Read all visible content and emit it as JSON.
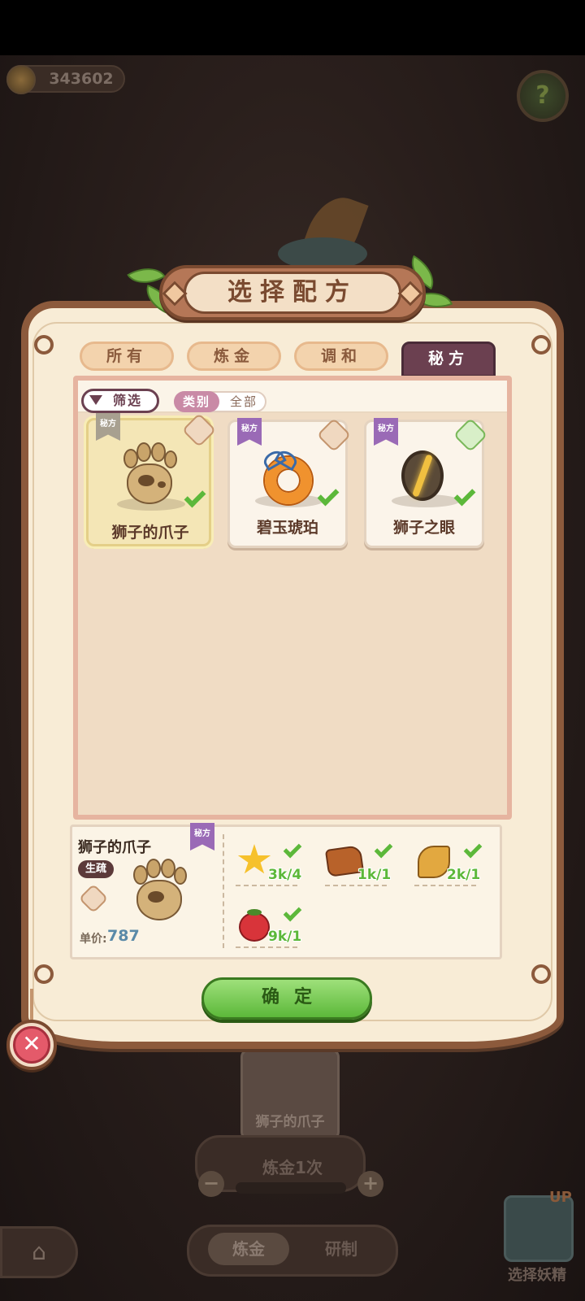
{
  "hud": {
    "coins": "343602"
  },
  "dialog": {
    "title": "选择配方",
    "tabs": [
      {
        "label": "所有",
        "active": false
      },
      {
        "label": "炼金",
        "active": false
      },
      {
        "label": "调和",
        "active": false
      },
      {
        "label": "秘方",
        "active": true
      }
    ],
    "filter": {
      "button_label": "筛选",
      "category_label": "类别",
      "category_value": "全部"
    },
    "recipes": [
      {
        "name": "狮子的爪子",
        "tag": "秘方",
        "icon": "paw-icon",
        "selected": true,
        "owned": true
      },
      {
        "name": "碧玉琥珀",
        "tag": "秘方",
        "icon": "amber-ring-icon",
        "selected": false,
        "owned": true
      },
      {
        "name": "狮子之眼",
        "tag": "秘方",
        "icon": "lion-eye-icon",
        "selected": false,
        "owned": true
      }
    ],
    "detail": {
      "name": "狮子的爪子",
      "tag": "秘方",
      "type_badge": "生疏",
      "price_label": "单价:",
      "price_value": "787",
      "ingredients": [
        {
          "icon": "star-icon",
          "count": "3k/4"
        },
        {
          "icon": "ore-icon",
          "count": "1k/1"
        },
        {
          "icon": "wheat-icon",
          "count": "2k/1"
        },
        {
          "icon": "tomato-icon",
          "count": "9k/1"
        }
      ]
    },
    "confirm_label": "确定"
  },
  "background": {
    "card_name": "狮子的爪子",
    "alchemy_count": "炼金1次",
    "nav": {
      "alchemy": "炼金",
      "research": "研制"
    },
    "fairy_label": "选择妖精",
    "fairy_up": "UP"
  },
  "colors": {
    "panel": "#f8ecd6",
    "border": "#8c5a3c",
    "active_tab": "#6b4050",
    "confirm": "#5cb83a"
  }
}
